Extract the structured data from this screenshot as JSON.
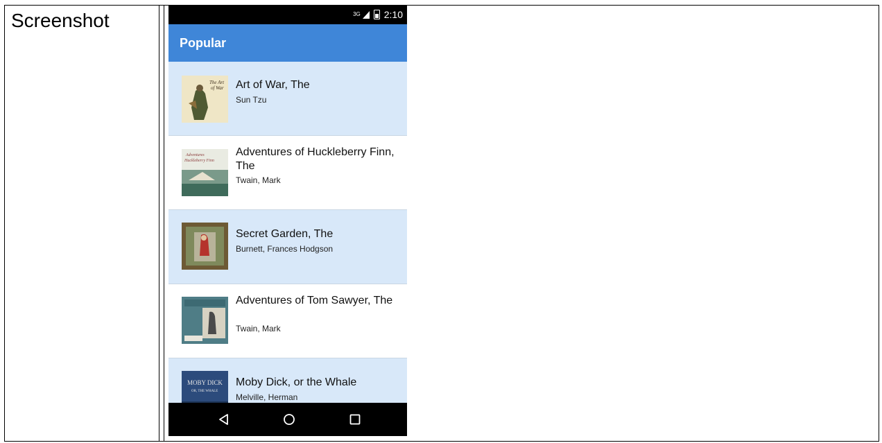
{
  "document": {
    "cell_label": "Screenshot"
  },
  "status_bar": {
    "network": "3G",
    "time": "2:10"
  },
  "app_bar": {
    "title": "Popular"
  },
  "books": [
    {
      "title": "Art of War, The",
      "author": "Sun Tzu",
      "cover_text": "The Art of War"
    },
    {
      "title": "Adventures of Huckleberry Finn, The",
      "author": "Twain, Mark",
      "cover_text": "Adventures Huckleberry Finn"
    },
    {
      "title": "Secret Garden, The",
      "author": "Burnett, Frances Hodgson",
      "cover_text": ""
    },
    {
      "title": "Adventures of Tom Sawyer, The",
      "author": "Twain, Mark",
      "cover_text": ""
    },
    {
      "title": "Moby Dick, or the Whale",
      "author": "Melville, Herman",
      "cover_text": "Moby Dick"
    }
  ],
  "nav_bar": {
    "back": "back-icon",
    "home": "home-icon",
    "recents": "recents-icon"
  },
  "colors": {
    "app_bar": "#3f86d8",
    "row_highlight": "#d8e8f9"
  }
}
